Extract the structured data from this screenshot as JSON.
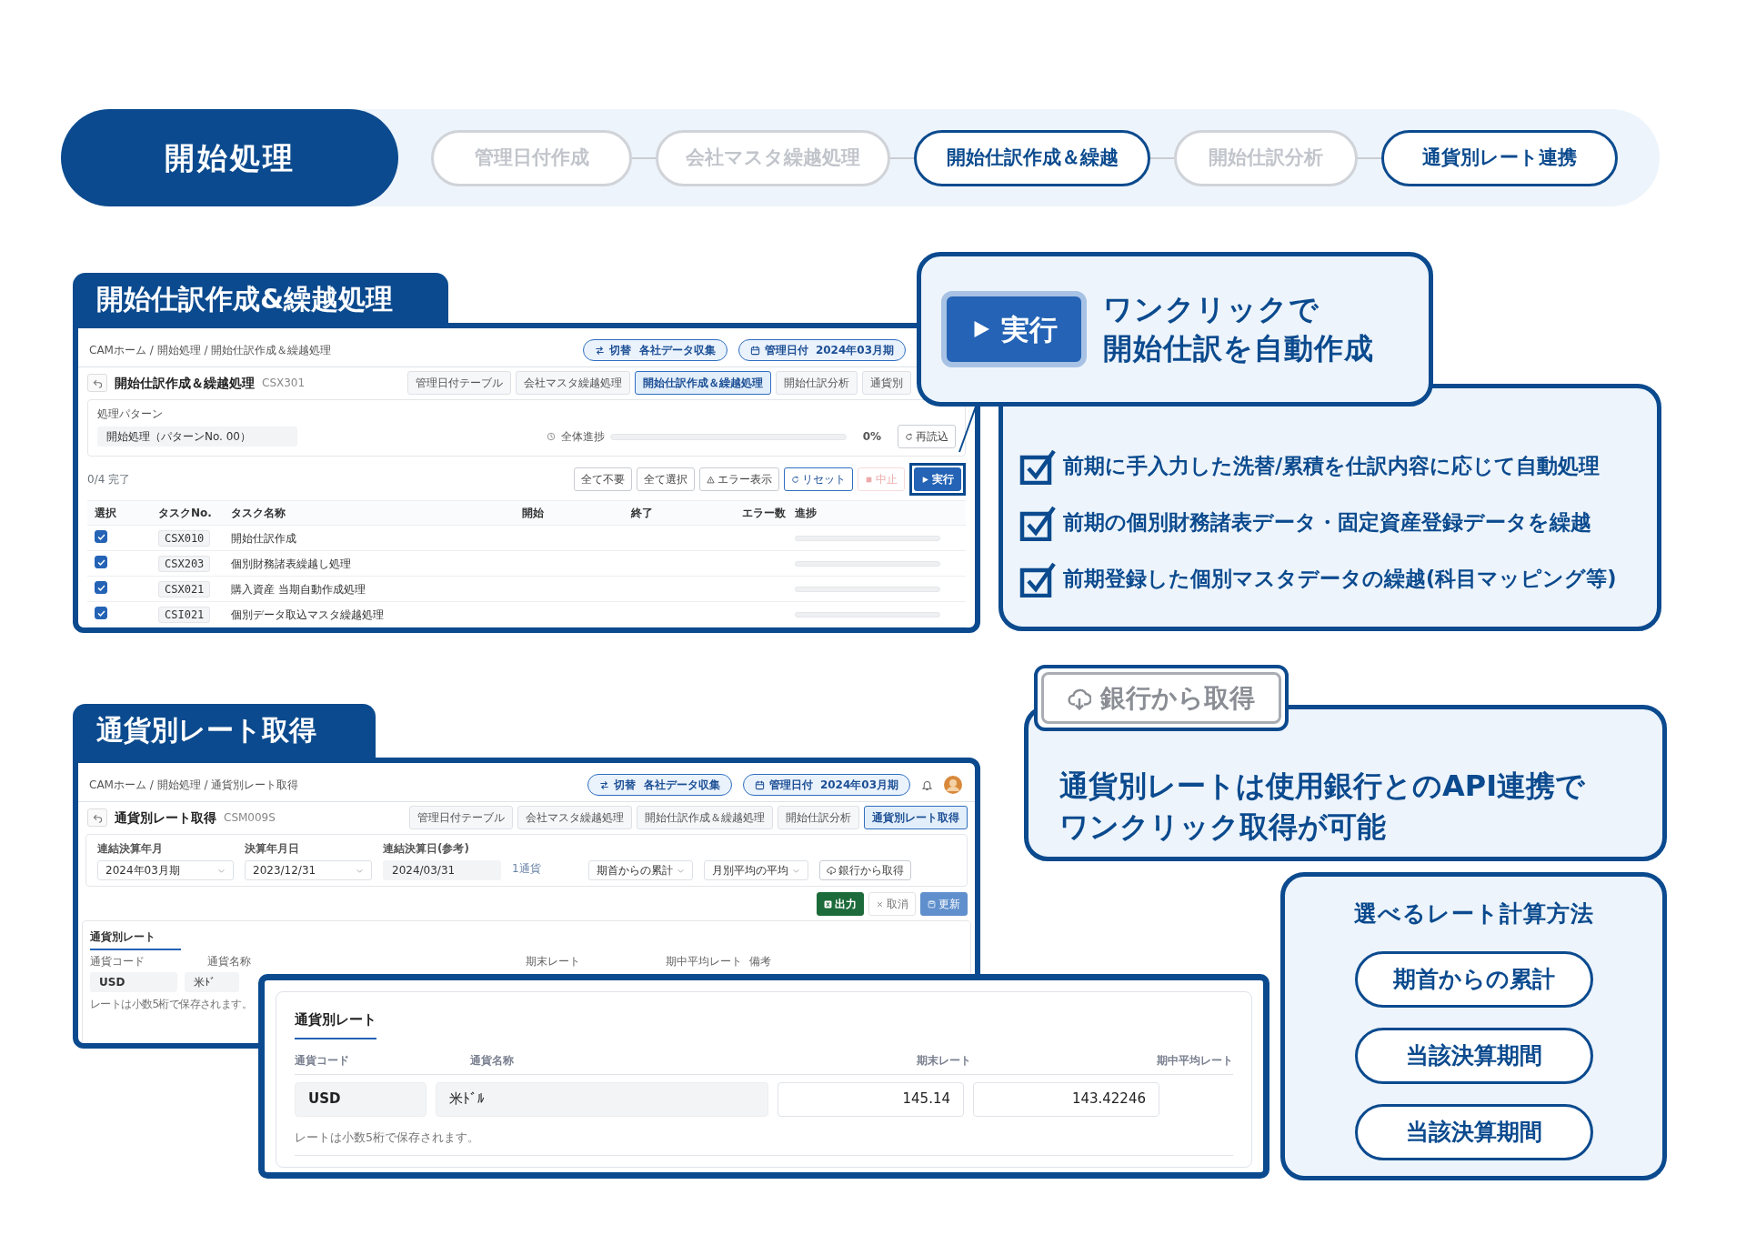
{
  "phase_bar": {
    "title": "開始処理",
    "steps": [
      {
        "label": "管理日付作成",
        "active": false
      },
      {
        "label": "会社マスタ繰越処理",
        "active": false
      },
      {
        "label": "開始仕訳作成＆繰越",
        "active": true
      },
      {
        "label": "開始仕訳分析",
        "active": false
      },
      {
        "label": "通貨別レート連携",
        "active": true
      }
    ]
  },
  "journal_panel": {
    "heading": "開始仕訳作成&繰越処理",
    "screen": {
      "breadcrumb": "CAMホーム / 開始処理 / 開始仕訳作成＆繰越処理",
      "header_buttons": [
        {
          "kind": "switch",
          "label": "切替",
          "value": "各社データ収集"
        },
        {
          "kind": "date",
          "label": "管理日付",
          "value": "2024年03月期"
        }
      ],
      "title": "開始仕訳作成＆繰越処理",
      "code": "CSX301",
      "tabs": [
        {
          "label": "管理日付テーブル",
          "selected": false
        },
        {
          "label": "会社マスタ繰越処理",
          "selected": false
        },
        {
          "label": "開始仕訳作成＆繰越処理",
          "selected": true
        },
        {
          "label": "開始仕訳分析",
          "selected": false
        },
        {
          "label": "通貨別",
          "selected": false
        }
      ],
      "pattern_label": "処理パターン",
      "pattern_value": "開始処理（パターンNo. 00）",
      "progress": {
        "label": "全体進捗",
        "level": 0,
        "reading": "0%"
      },
      "reload_label": "再読込",
      "done_count": "0/4 完了",
      "actions": [
        {
          "kind": "plain",
          "label": "全て不要",
          "disabled": false
        },
        {
          "kind": "plain",
          "label": "全て選択",
          "disabled": false
        },
        {
          "kind": "warning",
          "label": "エラー表示",
          "disabled": false
        },
        {
          "kind": "reset",
          "label": "リセット",
          "disabled": false
        },
        {
          "kind": "stop",
          "label": "中止",
          "disabled": true
        },
        {
          "kind": "run",
          "label": "実行",
          "disabled": false
        }
      ],
      "columns": [
        "選択",
        "タスクNo.",
        "タスク名称",
        "開始",
        "終了",
        "エラー数",
        "進捗"
      ],
      "rows": [
        {
          "checked": true,
          "code": "CSX010",
          "name": "開始仕訳作成",
          "level": 0
        },
        {
          "checked": true,
          "code": "CSX203",
          "name": "個別財務諸表繰越し処理",
          "level": 0
        },
        {
          "checked": true,
          "code": "CSX021",
          "name": "購入資産 当期自動作成処理",
          "level": 0
        },
        {
          "checked": true,
          "code": "CSI021",
          "name": "個別データ取込マスタ繰越処理",
          "level": 0
        }
      ]
    }
  },
  "run_callout": {
    "button_label": "実行",
    "lines": [
      "ワンクリックで",
      "開始仕訳を自動作成"
    ]
  },
  "feature_list": {
    "items": [
      {
        "text": "前期に手入力した洗替/累積を仕訳内容に応じて自動処理",
        "checked": true
      },
      {
        "text": "前期の個別財務諸表データ・固定資産登録データを繰越",
        "checked": true
      },
      {
        "text": "前期登録した個別マスタデータの繰越(科目マッピング等)",
        "checked": true
      }
    ]
  },
  "rate_panel": {
    "heading": "通貨別レート取得",
    "screen": {
      "breadcrumb": "CAMホーム / 開始処理 / 通貨別レート取得",
      "header_buttons": [
        {
          "kind": "switch",
          "label": "切替",
          "value": "各社データ収集"
        },
        {
          "kind": "date",
          "label": "管理日付",
          "value": "2024年03月期"
        }
      ],
      "title": "通貨別レート取得",
      "code": "CSM009S",
      "tabs": [
        {
          "label": "管理日付テーブル",
          "selected": false
        },
        {
          "label": "会社マスタ繰越処理",
          "selected": false
        },
        {
          "label": "開始仕訳作成＆繰越処理",
          "selected": false
        },
        {
          "label": "開始仕訳分析",
          "selected": false
        },
        {
          "label": "通貨別レート取得",
          "selected": true
        }
      ],
      "filters": [
        {
          "kind": "select",
          "label": "連結決算年月",
          "value": "2024年03月期"
        },
        {
          "kind": "select",
          "label": "決算年月日",
          "value": "2023/12/31"
        },
        {
          "kind": "readonly",
          "label": "連結決算日(参考)",
          "value": "2024/03/31"
        }
      ],
      "currency_count": "1通貨",
      "method_selects": [
        "期首からの累計",
        "月別平均の平均"
      ],
      "fetch_button": "銀行から取得",
      "actions": [
        {
          "kind": "export",
          "label": "出力",
          "disabled": false
        },
        {
          "kind": "cancel",
          "label": "取消",
          "disabled": true
        },
        {
          "kind": "save",
          "label": "更新",
          "disabled": true
        }
      ],
      "card_tab": "通貨別レート",
      "columns": [
        "通貨コード",
        "通貨名称",
        "期末レート",
        "期中平均レート",
        "備考"
      ],
      "row": {
        "code": "USD",
        "name": "米ﾄﾞ"
      },
      "note": "レートは小数5桁で保存されます。"
    }
  },
  "rate_table_zoom": {
    "card_tab": "通貨別レート",
    "columns": [
      "通貨コード",
      "通貨名称",
      "期末レート",
      "期中平均レート"
    ],
    "rows": [
      {
        "code": "USD",
        "name": "米ﾄﾞﾙ",
        "closing_rate": "145.14",
        "average_rate": "143.42246"
      }
    ],
    "note": "レートは小数5桁で保存されます。"
  },
  "bank_callout": {
    "button_label": "銀行から取得",
    "lines": [
      "通貨別レートは使用銀行とのAPI連携で",
      "ワンクリック取得が可能"
    ]
  },
  "rate_methods": {
    "title": "選べるレート計算方法",
    "options": [
      "期首からの累計",
      "当該決算期間",
      "当該決算期間"
    ]
  }
}
